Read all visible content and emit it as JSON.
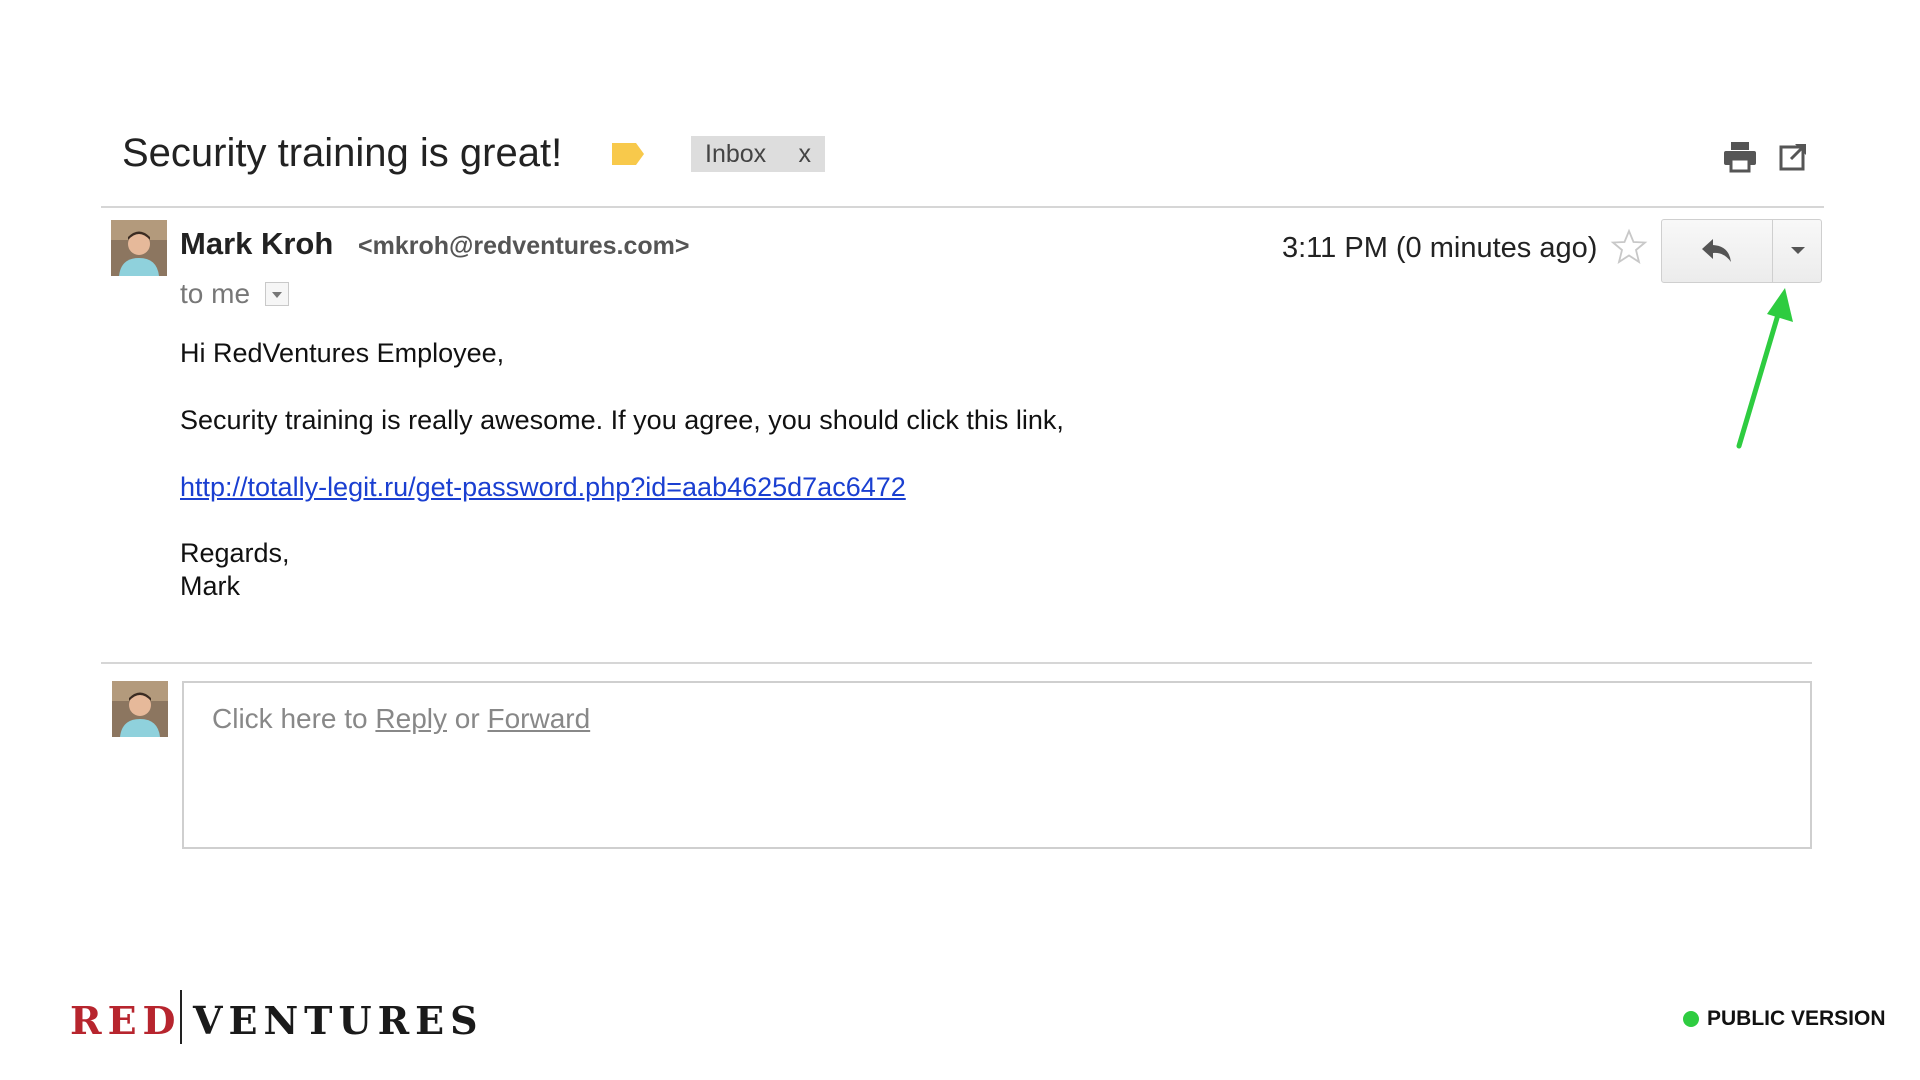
{
  "header": {
    "subject": "Security training is great!",
    "label_chip": {
      "text": "Inbox",
      "close": "x"
    },
    "label_color": "#f8c94b"
  },
  "message": {
    "sender_name": "Mark Kroh",
    "sender_email": "<mkroh@redventures.com>",
    "recipient": "to me",
    "timestamp": "3:11 PM (0 minutes ago)",
    "body": {
      "greeting": "Hi RedVentures Employee,",
      "paragraph": "Security training is really awesome. If you agree, you should click this link,",
      "link": "http://totally-legit.ru/get-password.php?id=aab4625d7ac6472",
      "regards": "Regards,",
      "signature": "Mark"
    }
  },
  "reply_box": {
    "prefix": "Click here to ",
    "reply_link": "Reply",
    "middle": " or ",
    "forward_link": "Forward"
  },
  "annotation": {
    "arrow_color": "#2ecc40"
  },
  "footer": {
    "brand_left": "RED",
    "brand_right": "VENTURES",
    "brand_red": "#b7252e",
    "status_label": "PUBLIC VERSION",
    "status_color": "#2ecc40"
  },
  "icons": {
    "print": "print-icon",
    "new_window": "open-in-new-window-icon",
    "star": "star-icon",
    "reply": "reply-arrow-icon",
    "more": "chevron-down-icon",
    "label": "label-tag-icon"
  }
}
